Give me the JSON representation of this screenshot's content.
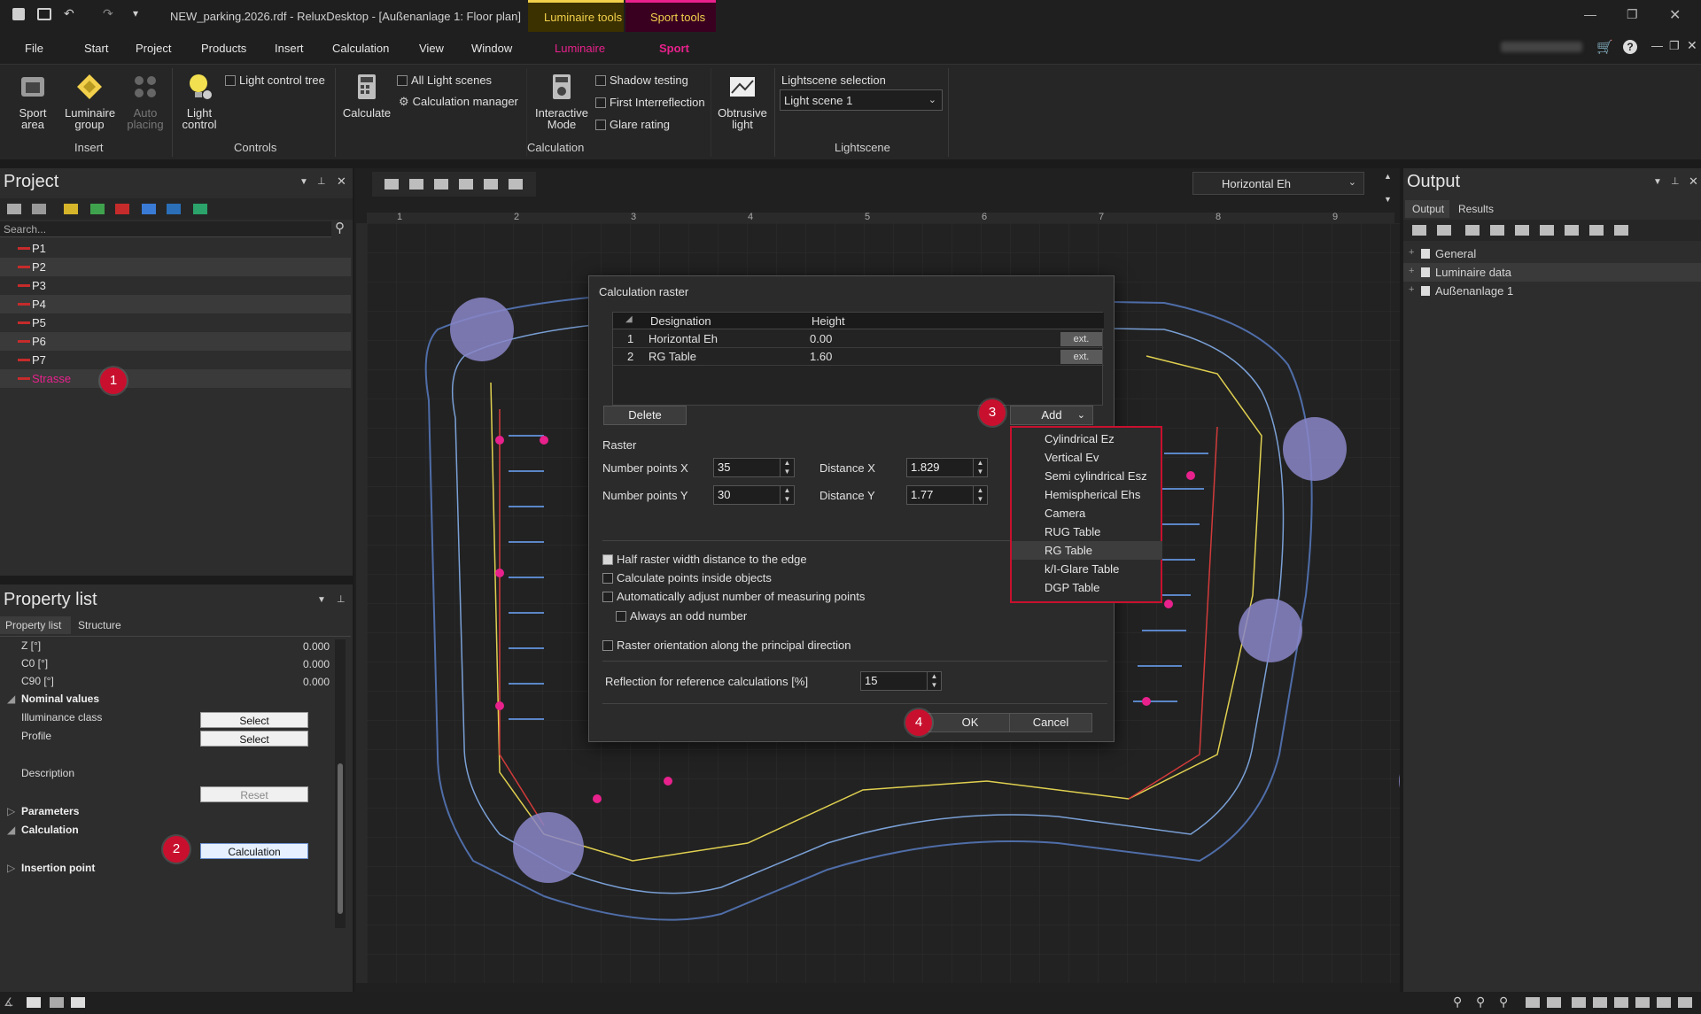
{
  "window": {
    "title": "NEW_parking.2026.rdf - ReluxDesktop - [Außenanlage 1: Floor plan]",
    "context_tabs": [
      "Luminaire tools",
      "Sport tools"
    ],
    "controls": [
      "minimize",
      "restore",
      "close"
    ]
  },
  "menu": [
    "File",
    "Start",
    "Project",
    "Products",
    "Insert",
    "Calculation",
    "View",
    "Window",
    "Luminaire",
    "Sport"
  ],
  "ribbon": {
    "insert_group": {
      "name": "Insert",
      "buttons": [
        "Sport area",
        "Luminaire group",
        "Auto placing"
      ]
    },
    "controls_group": {
      "name": "Controls",
      "button": "Light control",
      "checkbox": "Light control tree"
    },
    "calculation_group": {
      "name": "Calculation",
      "calculate": "Calculate",
      "all_light_scenes": "All Light scenes",
      "calc_manager": "Calculation manager",
      "interactive_mode": "Interactive Mode",
      "shadow_testing": "Shadow testing",
      "first_interreflection": "First Interreflection",
      "glare_rating": "Glare rating",
      "obtrusive_light": "Obtrusive light"
    },
    "lightscene_group": {
      "name": "Lightscene",
      "label": "Lightscene selection",
      "selected": "Light scene 1"
    }
  },
  "project": {
    "title": "Project",
    "search_placeholder": "Search...",
    "items": [
      "P1",
      "P2",
      "P3",
      "P4",
      "P5",
      "P6",
      "P7",
      "Strasse"
    ]
  },
  "property_list": {
    "title": "Property list",
    "tabs": [
      "Property list",
      "Structure"
    ],
    "rows": [
      {
        "label": "Z [°]",
        "value": "0.000"
      },
      {
        "label": "C0 [°]",
        "value": "0.000"
      },
      {
        "label": "C90 [°]",
        "value": "0.000"
      }
    ],
    "nominal_values": "Nominal values",
    "illuminance_class": "Illuminance class",
    "profile": "Profile",
    "select": "Select",
    "description": "Description",
    "reset": "Reset",
    "parameters": "Parameters",
    "calculation": "Calculation",
    "calculation_button": "Calculation",
    "insertion_point": "Insertion point"
  },
  "viewport": {
    "view_selector": "Horizontal Eh",
    "ruler_numbers": [
      "1",
      "2",
      "3",
      "4",
      "5",
      "6",
      "7",
      "8",
      "9"
    ]
  },
  "dialog": {
    "title": "Calculation raster",
    "table_headers": [
      "Designation",
      "Height"
    ],
    "rows": [
      {
        "num": "1",
        "designation": "Horizontal Eh",
        "height": "0.00",
        "ext": "ext."
      },
      {
        "num": "2",
        "designation": "RG Table",
        "height": "1.60",
        "ext": "ext."
      }
    ],
    "delete": "Delete",
    "add": "Add",
    "raster_label": "Raster",
    "num_points_x": "Number points X",
    "num_points_x_val": "35",
    "num_points_y": "Number points Y",
    "num_points_y_val": "30",
    "distance_x": "Distance X",
    "distance_x_val": "1.829",
    "distance_y": "Distance Y",
    "distance_y_val": "1.77",
    "half_raster": "Half raster width distance to the edge",
    "inside_objects": "Calculate points inside objects",
    "auto_adjust": "Automatically adjust number of measuring points",
    "odd_number": "Always an odd number",
    "orientation": "Raster orientation along the principal direction",
    "reflection": "Reflection for reference calculations [%]",
    "reflection_val": "15",
    "ok": "OK",
    "cancel": "Cancel"
  },
  "add_dropdown": [
    "Cylindrical Ez",
    "Vertical Ev",
    "Semi cylindrical Esz",
    "Hemispherical Ehs",
    "Camera",
    "RUG Table",
    "RG Table",
    "k/I-Glare Table",
    "DGP Table"
  ],
  "output": {
    "title": "Output",
    "tabs": [
      "Output",
      "Results"
    ],
    "tree": [
      "General",
      "Luminaire data",
      "Außenanlage 1"
    ]
  },
  "badges": [
    "1",
    "2",
    "3",
    "4"
  ],
  "colors": {
    "accent": "#e8218c",
    "badge": "#c8102e",
    "highlight_tab": "#f2d04b"
  }
}
